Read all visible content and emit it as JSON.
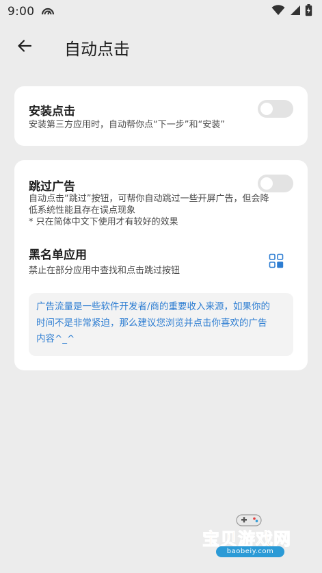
{
  "status_bar": {
    "time": "9:00",
    "icons": [
      "gauge-icon",
      "wifi-icon",
      "cell-signal-icon",
      "battery-charging-icon"
    ]
  },
  "app_bar": {
    "back_icon": "arrow-left-icon",
    "title": "自动点击"
  },
  "install_card": {
    "title": "安装点击",
    "description": "安装第三方应用时，自动帮你点“下一步”和“安装”",
    "toggle_on": false
  },
  "skip_ad_card": {
    "title": "跳过广告",
    "description_line1": "自动点击“跳过”按钮，可帮你自动跳过一些开屏广告，但会降",
    "description_line2": "低系统性能且存在误点现象",
    "note": "* 只在简体中文下使用才有较好的效果",
    "toggle_on": false,
    "blacklist": {
      "title": "黑名单应用",
      "description": "禁止在部分应用中查找和点击跳过按钮",
      "icon": "apps-grid-icon"
    },
    "notice": {
      "line1": "广告流量是一些软件开发者/商的重要收入来源，如果你的",
      "line2": "时间不是非常紧迫，那么建议您浏览并点击你喜欢的广告",
      "line3": "内容^_^"
    }
  },
  "watermark": {
    "text": "宝贝游戏网",
    "url": "baobeiy.com"
  },
  "colors": {
    "background": "#ececec",
    "card": "#ffffff",
    "notice_text": "#2d7dd2",
    "toggle_off": "#e3e3e3",
    "accent": "#2d7dd2"
  }
}
